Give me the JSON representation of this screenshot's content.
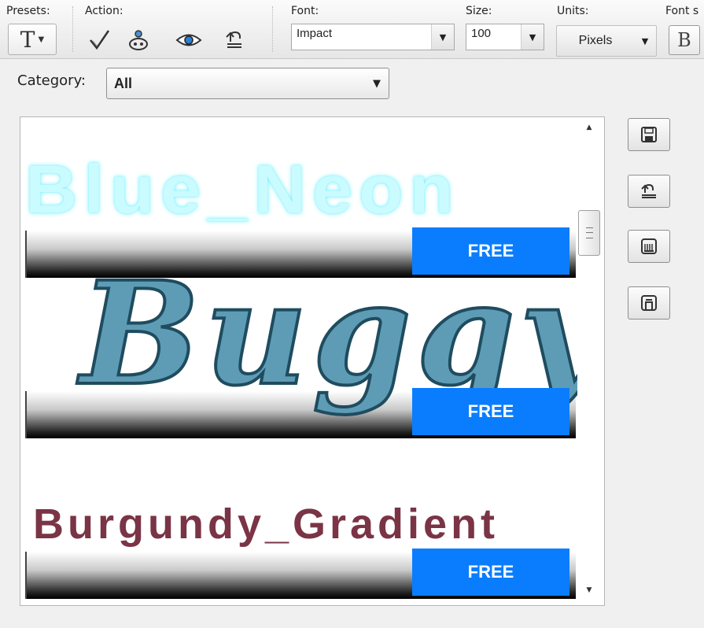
{
  "toolbar": {
    "presets_label": "Presets:",
    "action_label": "Action:",
    "font_label": "Font:",
    "size_label": "Size:",
    "units_label": "Units:",
    "font_style_label": "Font s",
    "presets_icon": "text-tool-icon",
    "presets_glyph": "T",
    "actions": [
      {
        "name": "apply",
        "icon": "checkmark-icon"
      },
      {
        "name": "apply-to-selected",
        "icon": "apply-style-icon"
      },
      {
        "name": "preview",
        "icon": "eye-icon"
      },
      {
        "name": "reset",
        "icon": "reset-icon"
      }
    ],
    "font_value": "Impact",
    "size_value": "100",
    "units_value": "Pixels",
    "bold_glyph": "B"
  },
  "category": {
    "label": "Category:",
    "value": "All"
  },
  "styles": [
    {
      "name": "Blue_Neon",
      "badge": "FREE"
    },
    {
      "name": "Buggy",
      "badge": "FREE"
    },
    {
      "name": "Burgundy_Gradient",
      "badge": "FREE"
    }
  ],
  "side_buttons": [
    "save-icon",
    "load-icon",
    "save-as-icon",
    "delete-icon"
  ],
  "colors": {
    "badge": "#0a7dff",
    "neon": "#cafbff",
    "buggy": "#5e9cb6",
    "burgundy": "#7a3446"
  }
}
